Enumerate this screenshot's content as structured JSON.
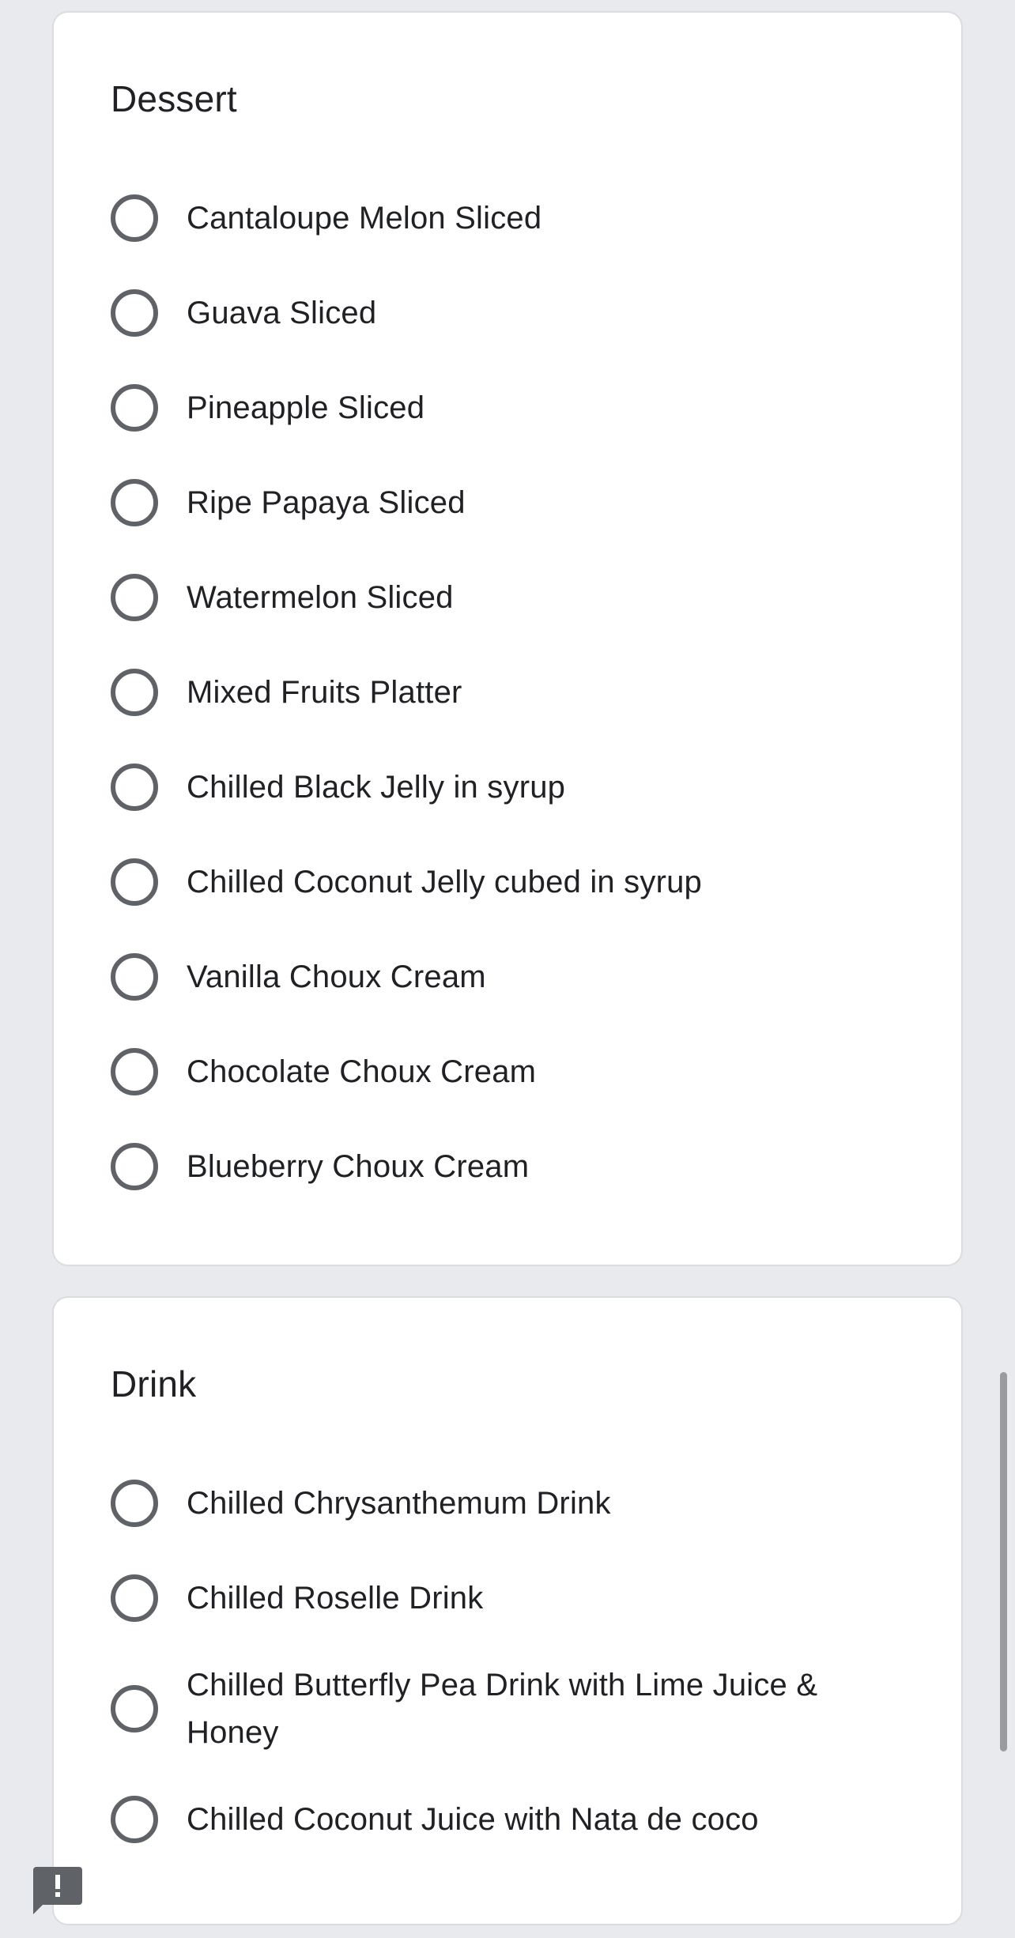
{
  "questions": [
    {
      "title": "Dessert",
      "options": [
        "Cantaloupe Melon Sliced",
        "Guava Sliced",
        "Pineapple Sliced",
        "Ripe Papaya Sliced",
        "Watermelon Sliced",
        "Mixed Fruits Platter",
        "Chilled Black Jelly in syrup",
        "Chilled Coconut Jelly cubed in syrup",
        "Vanilla Choux Cream",
        "Chocolate Choux Cream",
        "Blueberry Choux Cream"
      ]
    },
    {
      "title": "Drink",
      "options": [
        "Chilled Chrysanthemum Drink",
        "Chilled Roselle Drink",
        "Chilled Butterfly Pea Drink with Lime Juice & Honey",
        "Chilled Coconut Juice with Nata de coco"
      ]
    }
  ],
  "selected": {
    "dessert": null,
    "drink": null
  },
  "icons": {
    "radio": "radio-unchecked-icon",
    "feedback": "report-feedback-icon"
  },
  "colors": {
    "background": "#e8eaed",
    "card": "#ffffff",
    "card_border": "#dadce0",
    "radio_outline": "#5f6368",
    "text": "#202124",
    "scrollbar": "#9a9b9d",
    "feedback_icon": "#5f6368"
  }
}
